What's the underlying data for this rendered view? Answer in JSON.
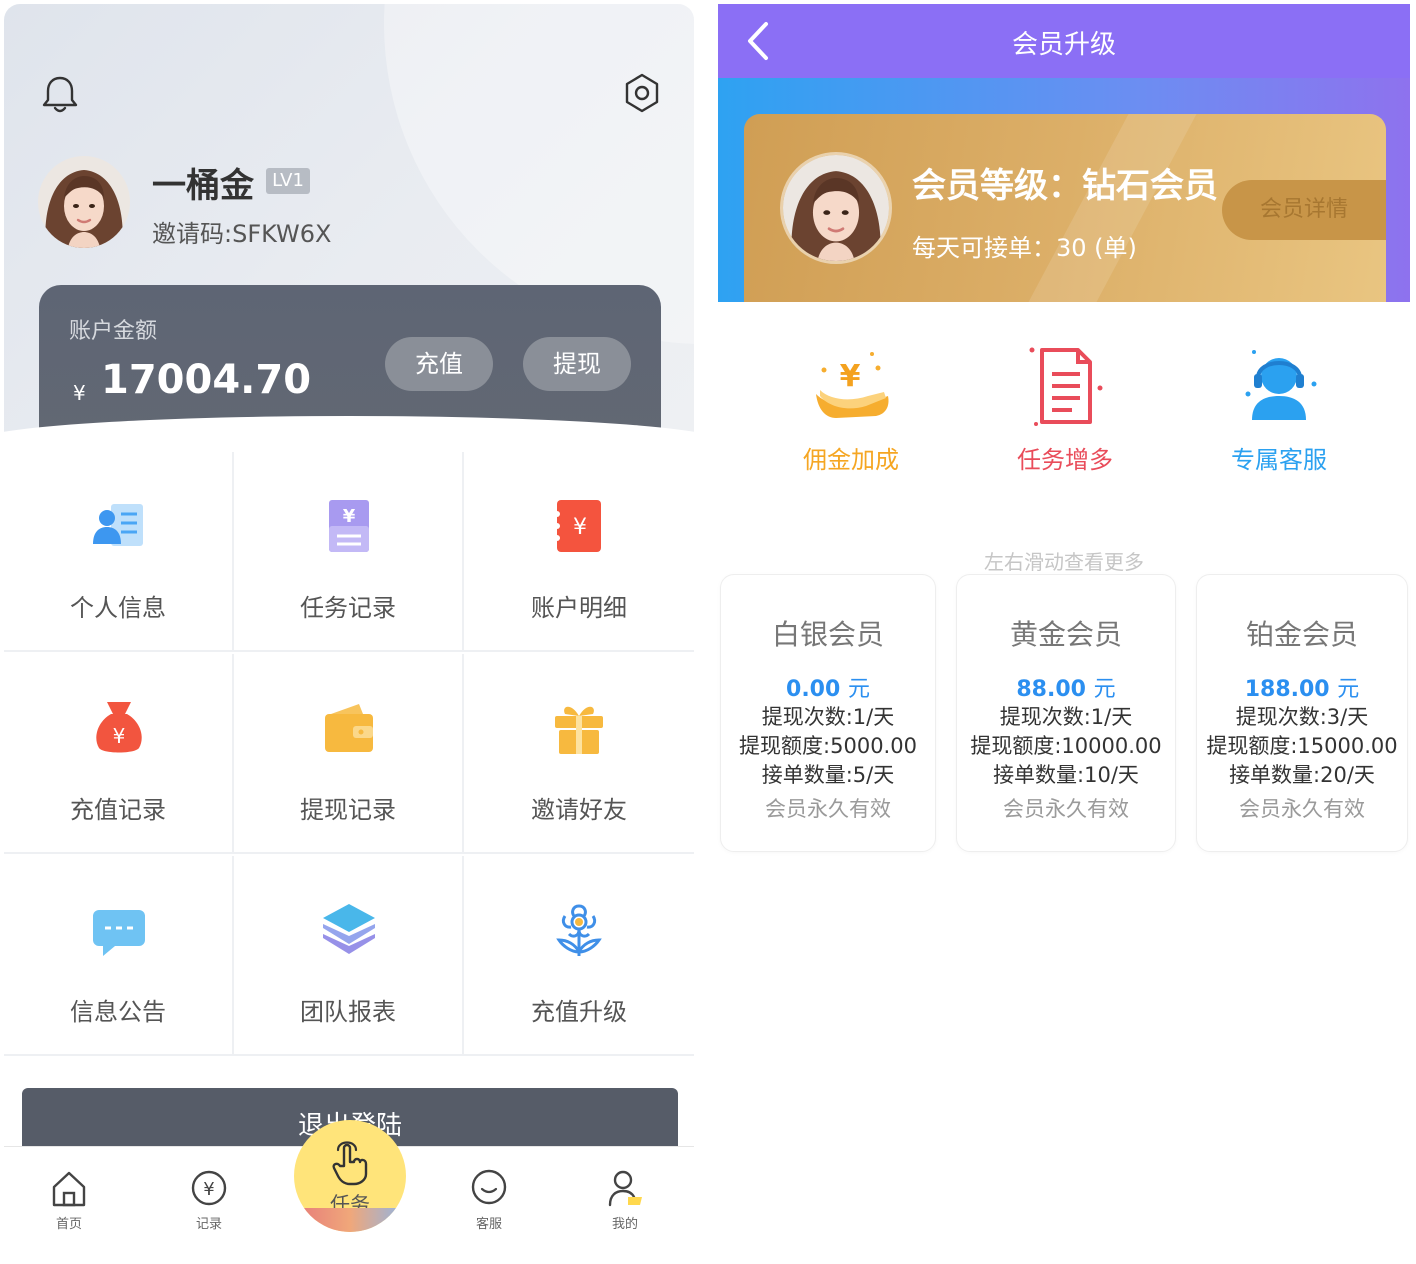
{
  "left": {
    "user": {
      "name": "一桶金",
      "level": "LV1",
      "invite": "邀请码:SFKW6X"
    },
    "balance": {
      "label": "账户金额",
      "currency": "¥",
      "amount": "17004.70"
    },
    "buttons": {
      "recharge": "充值",
      "withdraw": "提现"
    },
    "menu": [
      {
        "label": "个人信息",
        "icon": "profile-card-icon"
      },
      {
        "label": "任务记录",
        "icon": "task-record-icon"
      },
      {
        "label": "账户明细",
        "icon": "account-detail-icon"
      },
      {
        "label": "充值记录",
        "icon": "money-bag-icon"
      },
      {
        "label": "提现记录",
        "icon": "wallet-icon"
      },
      {
        "label": "邀请好友",
        "icon": "gift-icon"
      },
      {
        "label": "信息公告",
        "icon": "chat-bubble-icon"
      },
      {
        "label": "团队报表",
        "icon": "layers-icon"
      },
      {
        "label": "充值升级",
        "icon": "flower-icon"
      }
    ],
    "logout": "退出登陆",
    "tabs": {
      "home": "首页",
      "records": "记录",
      "task": "任务",
      "service": "客服",
      "mine": "我的"
    }
  },
  "right": {
    "title": "会员升级",
    "vip": {
      "level": "会员等级：钻石会员",
      "daily": "每天可接单：30 (单)",
      "detail_btn": "会员详情"
    },
    "benefits": [
      {
        "label": "佣金加成",
        "color": "#f5a623",
        "icon": "commission-icon"
      },
      {
        "label": "任务增多",
        "color": "#e94c5a",
        "icon": "document-icon"
      },
      {
        "label": "专属客服",
        "color": "#2ba1f0",
        "icon": "headset-icon"
      }
    ],
    "swipe_hint": "左右滑动查看更多",
    "plans": [
      {
        "name": "白银会员",
        "price": "0.00",
        "unit": "元",
        "times": "提现次数:1/天",
        "limit": "提现额度:5000.00",
        "orders": "接单数量:5/天",
        "validity": "会员永久有效"
      },
      {
        "name": "黄金会员",
        "price": "88.00",
        "unit": "元",
        "times": "提现次数:1/天",
        "limit": "提现额度:10000.00",
        "orders": "接单数量:10/天",
        "validity": "会员永久有效"
      },
      {
        "name": "铂金会员",
        "price": "188.00",
        "unit": "元",
        "times": "提现次数:3/天",
        "limit": "提现额度:15000.00",
        "orders": "接单数量:20/天",
        "validity": "会员永久有效"
      }
    ]
  }
}
